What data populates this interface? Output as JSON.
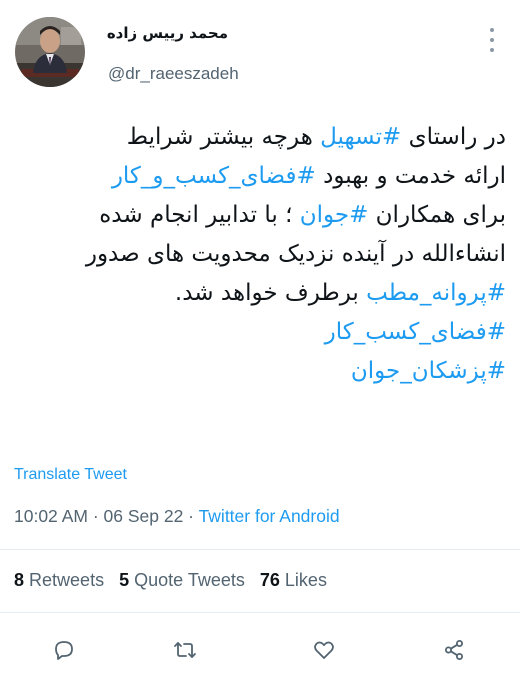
{
  "author": {
    "name": "محمد رییس زاده",
    "handle": "@dr_raeeszadeh"
  },
  "tweet": {
    "lines": [
      [
        {
          "text": "در راستای ",
          "tag": false
        },
        {
          "text": "#تسهیل",
          "tag": true
        },
        {
          "text": " هرچه بیشتر شرایط",
          "tag": false
        }
      ],
      [
        {
          "text": "ارائه خدمت و بهبود ",
          "tag": false
        },
        {
          "text": "#فضای_کسب_و_کار",
          "tag": true
        }
      ],
      [
        {
          "text": "برای همکاران ",
          "tag": false
        },
        {
          "text": "#جوان",
          "tag": true
        },
        {
          "text": " ؛ با تدابیر انجام شده",
          "tag": false
        }
      ],
      [
        {
          "text": "انشاءالله در آینده نزدیک محدویت های صدور",
          "tag": false
        }
      ],
      [
        {
          "text": "#پروانه_مطب",
          "tag": true
        },
        {
          "text": " برطرف خواهد شد.",
          "tag": false
        }
      ],
      [
        {
          "text": "#فضای_کسب_کار",
          "tag": true
        }
      ],
      [
        {
          "text": "#پزشکان_جوان",
          "tag": true
        }
      ]
    ]
  },
  "translate_label": "Translate Tweet",
  "meta": {
    "time": "10:02 AM",
    "separator": " · ",
    "date": "06 Sep 22",
    "source": "Twitter for Android"
  },
  "stats": {
    "retweets_count": "8",
    "retweets_label": "Retweets",
    "quotes_count": "5",
    "quotes_label": "Quote Tweets",
    "likes_count": "76",
    "likes_label": "Likes"
  },
  "actions": [
    {
      "name": "reply-icon"
    },
    {
      "name": "retweet-icon"
    },
    {
      "name": "like-icon"
    },
    {
      "name": "share-icon"
    }
  ],
  "colors": {
    "link": "#1d9bf0",
    "muted": "#536471",
    "text": "#0f1419",
    "icon": "#536471"
  }
}
